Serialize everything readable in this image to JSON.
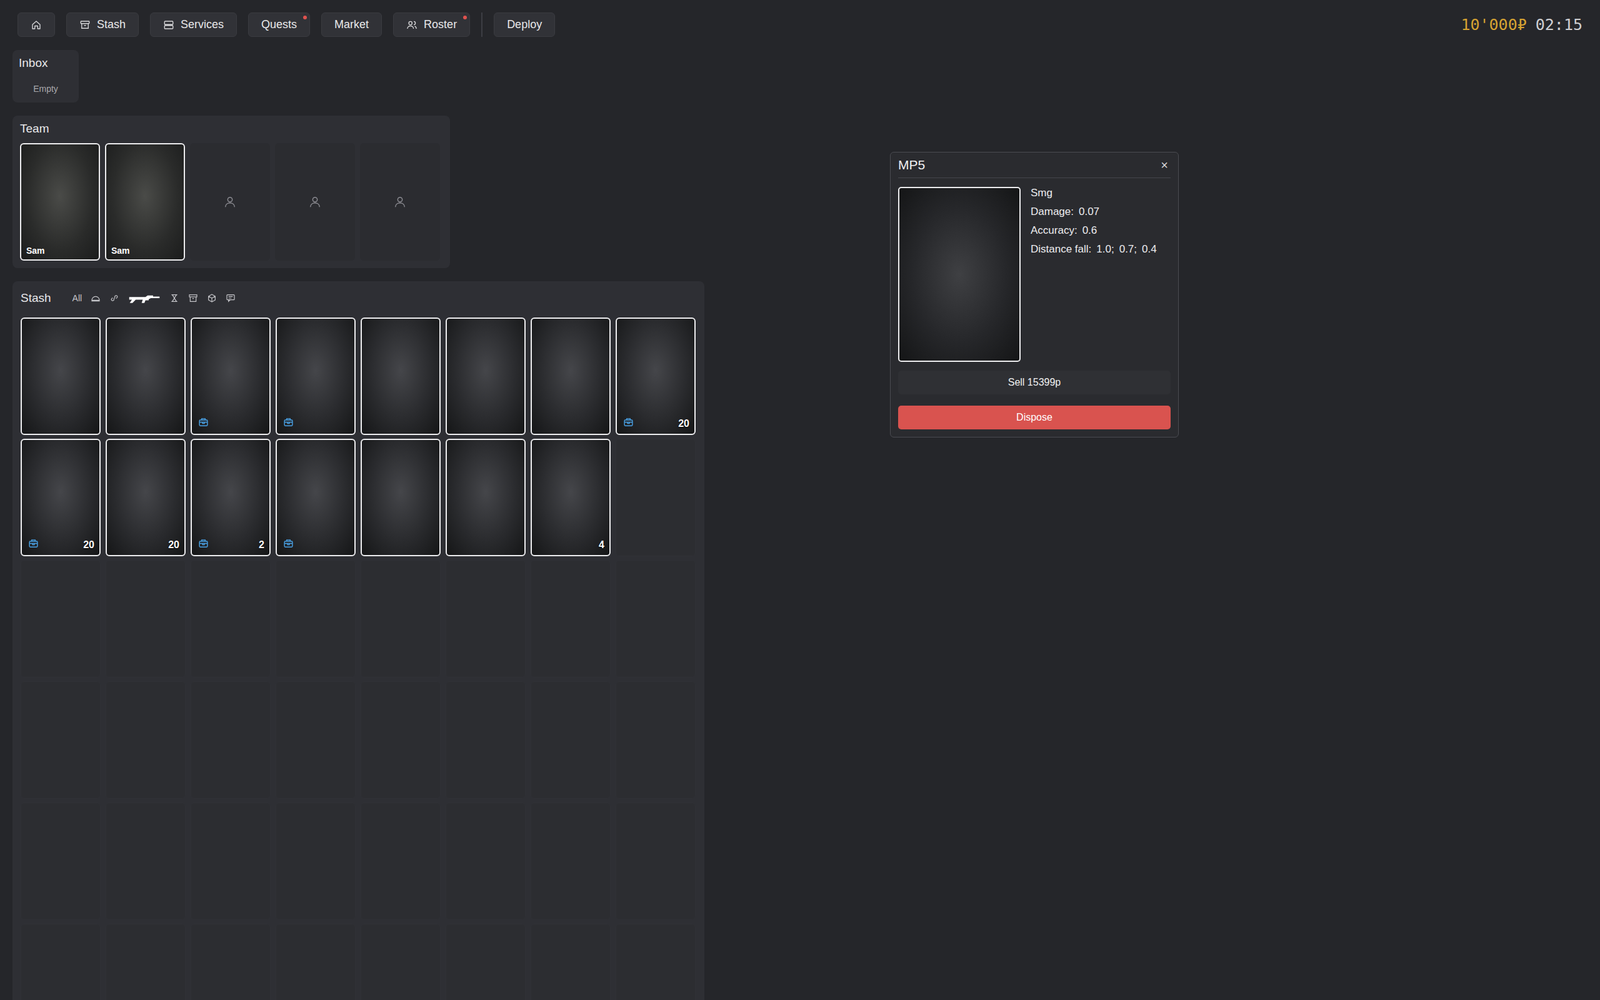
{
  "nav": {
    "items": [
      {
        "label": "Stash",
        "alert": false
      },
      {
        "label": "Services",
        "alert": false
      },
      {
        "label": "Quests",
        "alert": true
      },
      {
        "label": "Market",
        "alert": false
      },
      {
        "label": "Roster",
        "alert": true
      }
    ],
    "deploy": "Deploy"
  },
  "wallet": {
    "money": "10'000₽",
    "time": "02:15"
  },
  "inbox": {
    "title": "Inbox",
    "empty_text": "Empty"
  },
  "team": {
    "title": "Team",
    "slots": [
      {
        "filled": true,
        "name": "Sam"
      },
      {
        "filled": true,
        "name": "Sam"
      },
      {
        "filled": false,
        "name": ""
      },
      {
        "filled": false,
        "name": ""
      },
      {
        "filled": false,
        "name": ""
      }
    ]
  },
  "stash": {
    "title": "Stash",
    "filters": [
      {
        "kind": "text",
        "label": "All",
        "selected": false
      },
      {
        "kind": "icon",
        "label": "",
        "selected": false
      },
      {
        "kind": "icon",
        "label": "",
        "selected": false
      },
      {
        "kind": "icon",
        "label": "",
        "selected": true
      },
      {
        "kind": "icon",
        "label": "",
        "selected": false
      },
      {
        "kind": "icon",
        "label": "",
        "selected": false
      },
      {
        "kind": "icon",
        "label": "",
        "selected": false
      },
      {
        "kind": "icon",
        "label": "",
        "selected": false
      }
    ],
    "items": [
      {
        "badge": false,
        "count": null
      },
      {
        "badge": false,
        "count": null
      },
      {
        "badge": true,
        "count": null
      },
      {
        "badge": true,
        "count": null
      },
      {
        "badge": false,
        "count": null
      },
      {
        "badge": false,
        "count": null
      },
      {
        "badge": false,
        "count": null
      },
      {
        "badge": true,
        "count": "20"
      },
      {
        "badge": true,
        "count": "20"
      },
      {
        "badge": false,
        "count": "20"
      },
      {
        "badge": true,
        "count": "2"
      },
      {
        "badge": true,
        "count": null
      },
      {
        "badge": false,
        "count": null
      },
      {
        "badge": false,
        "count": null
      },
      {
        "badge": false,
        "count": "4"
      }
    ]
  },
  "item_details": {
    "title": "MP5",
    "close": "×",
    "type": "Smg",
    "stats": [
      {
        "label": "Damage:",
        "value": "0.07"
      },
      {
        "label": "Accuracy:",
        "value": "0.6"
      }
    ],
    "distance_fall": {
      "label": "Distance fall:",
      "values": [
        "1.0;",
        "0.7;",
        "0.4"
      ]
    },
    "sell": "Sell 15399р",
    "dispose": "Dispose"
  }
}
